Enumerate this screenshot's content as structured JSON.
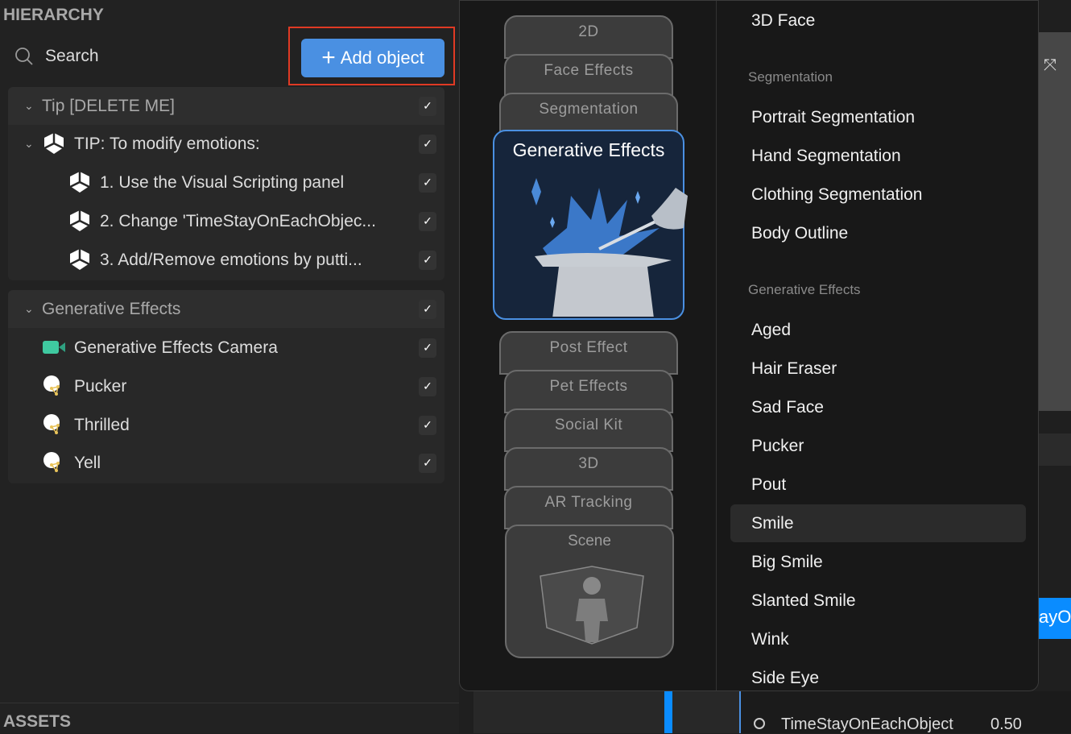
{
  "hierarchy": {
    "title": "HIERARCHY",
    "search_placeholder": "Search",
    "add_object_label": "Add object",
    "groups": [
      {
        "label": "Tip [DELETE ME]",
        "children": [
          {
            "label": "TIP: To modify emotions:"
          },
          {
            "label": "1. Use the Visual Scripting panel"
          },
          {
            "label": "2. Change 'TimeStayOnEachObjec..."
          },
          {
            "label": "3. Add/Remove emotions by putti..."
          }
        ]
      },
      {
        "label": "Generative Effects",
        "children": [
          {
            "label": "Generative Effects Camera",
            "icon": "camera-icon"
          },
          {
            "label": "Pucker",
            "icon": "face-mesh-icon"
          },
          {
            "label": "Thrilled",
            "icon": "face-mesh-icon"
          },
          {
            "label": "Yell",
            "icon": "face-mesh-icon"
          }
        ]
      }
    ]
  },
  "assets": {
    "title": "ASSETS"
  },
  "popup": {
    "categories": [
      "2D",
      "Face Effects",
      "Segmentation",
      "Generative Effects",
      "Post Effect",
      "Pet Effects",
      "Social Kit",
      "3D",
      "AR Tracking",
      "Scene"
    ],
    "selected_category": "Generative Effects",
    "top_item": "3D Face",
    "sections": [
      {
        "title": "Segmentation",
        "items": [
          "Portrait Segmentation",
          "Hand Segmentation",
          "Clothing Segmentation",
          "Body Outline"
        ]
      },
      {
        "title": "Generative Effects",
        "items": [
          "Aged",
          "Hair Eraser",
          "Sad Face",
          "Pucker",
          "Pout",
          "Smile",
          "Big Smile",
          "Slanted Smile",
          "Wink",
          "Side Eye"
        ]
      }
    ],
    "hovered_item": "Smile"
  },
  "background": {
    "param_name": "TimeStayOnEachObject",
    "param_value": "0.50",
    "partial_button": "ayO"
  },
  "colors": {
    "accent": "#4a90e2",
    "highlight_box": "#e03a24",
    "camera": "#3fc9a0"
  }
}
